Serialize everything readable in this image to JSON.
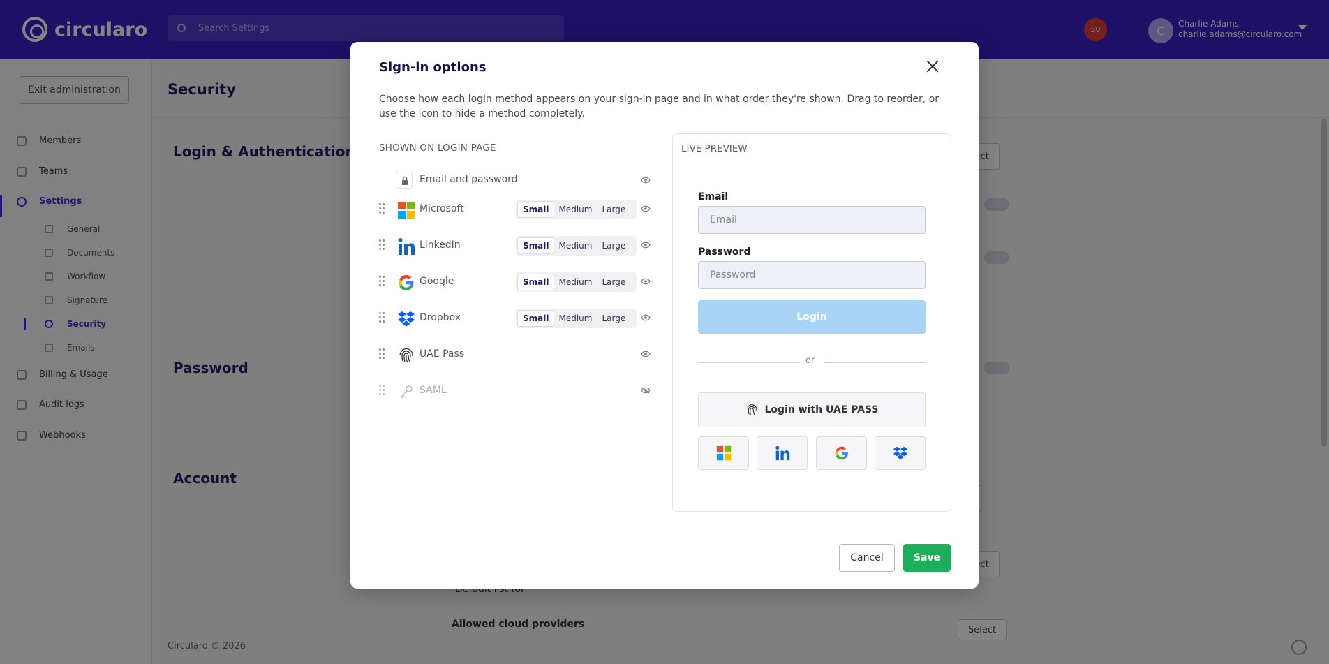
{
  "app": {
    "logo_text": "circularo",
    "search_placeholder": "Search Settings",
    "notification_count": "50",
    "user": {
      "initial": "C",
      "name": "Charlie Adams",
      "email": "charlie.adams@circularo.com"
    }
  },
  "sidebar": {
    "exit_label": "Exit administration",
    "items": [
      {
        "label": "Members",
        "icon": "user-icon"
      },
      {
        "label": "Teams",
        "icon": "team-icon"
      },
      {
        "label": "Settings",
        "icon": "gear-icon"
      },
      {
        "label": "Billing & Usage",
        "icon": "billing-icon"
      },
      {
        "label": "Audit logs",
        "icon": "audit-icon"
      },
      {
        "label": "Webhooks",
        "icon": "webhook-icon"
      }
    ],
    "sub_items": [
      {
        "label": "General"
      },
      {
        "label": "Documents"
      },
      {
        "label": "Workflow"
      },
      {
        "label": "Signature"
      },
      {
        "label": "Security"
      },
      {
        "label": "Emails"
      }
    ]
  },
  "page": {
    "title": "Security",
    "sections": [
      "Login & Authentication",
      "Password",
      "Account"
    ],
    "bg_select_label": "Select",
    "bg_row_label": "Allowed cloud providers",
    "bg_row_sub": "Default list for",
    "bg_select_short": "elect",
    "footer": "Circularo © 2026"
  },
  "modal": {
    "title": "Sign-in options",
    "description": "Choose how each login method appears on your sign-in page and in what order they're shown. Drag to reorder, or use the icon to hide a method completely.",
    "list_heading": "SHOWN ON LOGIN PAGE",
    "email_method": "Email and password",
    "methods": [
      {
        "label": "Microsoft",
        "icon": "microsoft-icon",
        "sizes": [
          "Small",
          "Medium",
          "Large"
        ],
        "selected": "Small",
        "visible": true
      },
      {
        "label": "LinkedIn",
        "icon": "linkedin-icon",
        "sizes": [
          "Small",
          "Medium",
          "Large"
        ],
        "selected": "Small",
        "visible": true
      },
      {
        "label": "Google",
        "icon": "google-icon",
        "sizes": [
          "Small",
          "Medium",
          "Large"
        ],
        "selected": "Small",
        "visible": true
      },
      {
        "label": "Dropbox",
        "icon": "dropbox-icon",
        "sizes": [
          "Small",
          "Medium",
          "Large"
        ],
        "selected": "Small",
        "visible": true
      },
      {
        "label": "UAE Pass",
        "icon": "fingerprint-icon",
        "visible": true
      },
      {
        "label": "SAML",
        "icon": "key-icon",
        "visible": false
      }
    ],
    "preview": {
      "heading": "LIVE PREVIEW",
      "email_label": "Email",
      "email_placeholder": "Email",
      "password_label": "Password",
      "password_placeholder": "Password",
      "login_label": "Login",
      "or_text": "or",
      "uae_label": "Login with UAE PASS"
    },
    "cancel_label": "Cancel",
    "save_label": "Save"
  },
  "colors": {
    "brand": "#3a1fc4",
    "save": "#1dae5a",
    "login_button": "#a8d4f6"
  }
}
